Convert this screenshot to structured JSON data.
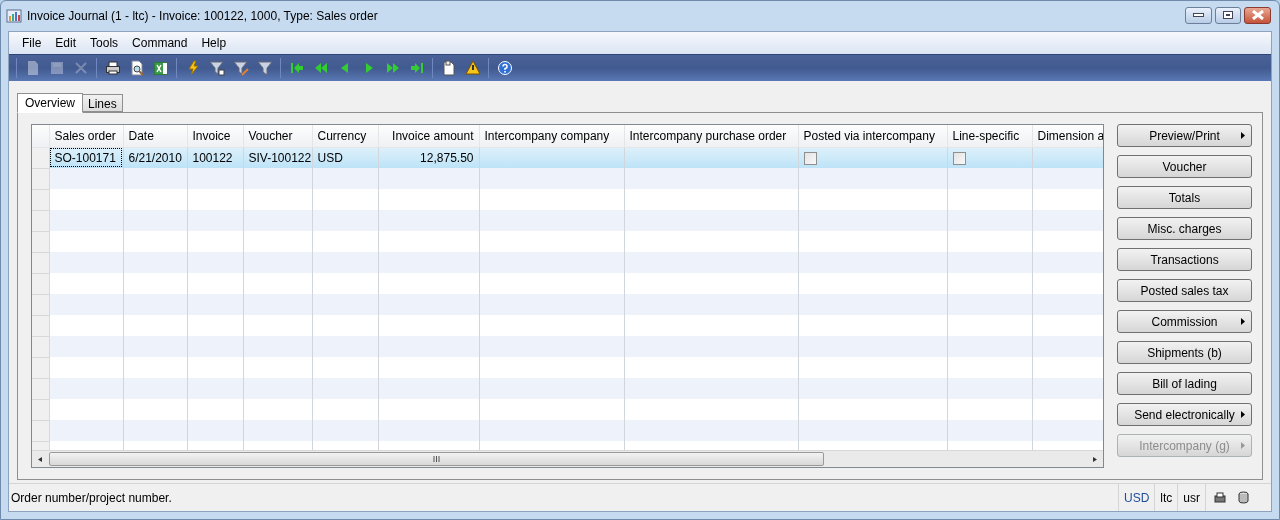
{
  "window": {
    "title": "Invoice Journal (1 - ltc) - Invoice: 100122, 1000, Type: Sales order"
  },
  "menu": [
    "File",
    "Edit",
    "Tools",
    "Command",
    "Help"
  ],
  "toolbar": [
    {
      "kind": "new",
      "disabled": true
    },
    {
      "kind": "save",
      "disabled": true
    },
    {
      "kind": "delete",
      "disabled": true
    },
    {
      "kind": "sep"
    },
    {
      "kind": "print",
      "disabled": false
    },
    {
      "kind": "preview",
      "disabled": false
    },
    {
      "kind": "excel",
      "disabled": false
    },
    {
      "kind": "sep"
    },
    {
      "kind": "filter-lightning",
      "disabled": false
    },
    {
      "kind": "filter-form",
      "disabled": false
    },
    {
      "kind": "filter-edit",
      "disabled": false
    },
    {
      "kind": "filter-remove",
      "disabled": false
    },
    {
      "kind": "sep"
    },
    {
      "kind": "first",
      "disabled": false
    },
    {
      "kind": "prev-page",
      "disabled": false
    },
    {
      "kind": "prev",
      "disabled": false
    },
    {
      "kind": "next",
      "disabled": false
    },
    {
      "kind": "next-page",
      "disabled": false
    },
    {
      "kind": "last",
      "disabled": false
    },
    {
      "kind": "sep"
    },
    {
      "kind": "document",
      "disabled": false
    },
    {
      "kind": "alert",
      "disabled": false
    },
    {
      "kind": "sep"
    },
    {
      "kind": "help",
      "disabled": false
    }
  ],
  "tabs": [
    {
      "label": "Overview",
      "selected": true
    },
    {
      "label": "Lines",
      "selected": false
    }
  ],
  "table": {
    "columns": [
      {
        "label": "Sales order"
      },
      {
        "label": "Date"
      },
      {
        "label": "Invoice"
      },
      {
        "label": "Voucher"
      },
      {
        "label": "Currency"
      },
      {
        "label": "Invoice amount"
      },
      {
        "label": "Intercompany company"
      },
      {
        "label": "Intercompany purchase order"
      },
      {
        "label": "Posted via intercompany"
      },
      {
        "label": "Line-specific"
      },
      {
        "label": "Dimension a"
      }
    ],
    "rows": [
      {
        "selected": true,
        "cells": [
          {
            "kind": "text",
            "text": "SO-100171"
          },
          {
            "kind": "text",
            "text": "6/21/2010"
          },
          {
            "kind": "text",
            "text": "100122"
          },
          {
            "kind": "text",
            "text": "SIV-100122"
          },
          {
            "kind": "text",
            "text": "USD"
          },
          {
            "kind": "text",
            "text": "12,875.50"
          },
          {
            "kind": "text",
            "text": ""
          },
          {
            "kind": "text",
            "text": ""
          },
          {
            "kind": "checkbox",
            "checked": false
          },
          {
            "kind": "checkbox",
            "checked": false
          },
          {
            "kind": "text",
            "text": ""
          }
        ]
      }
    ]
  },
  "buttons": [
    {
      "label": "Preview/Print",
      "menu": true,
      "disabled": false
    },
    {
      "label": "Voucher",
      "menu": false,
      "disabled": false
    },
    {
      "label": "Totals",
      "menu": false,
      "disabled": false
    },
    {
      "label": "Misc. charges",
      "menu": false,
      "disabled": false
    },
    {
      "label": "Transactions",
      "menu": false,
      "disabled": false
    },
    {
      "label": "Posted sales tax",
      "menu": false,
      "disabled": false
    },
    {
      "label": "Commission",
      "menu": true,
      "disabled": false
    },
    {
      "label": "Shipments (b)",
      "menu": false,
      "disabled": false
    },
    {
      "label": "Bill of lading",
      "menu": false,
      "disabled": false
    },
    {
      "label": "Send electronically",
      "menu": true,
      "disabled": false
    },
    {
      "label": "Intercompany (g)",
      "menu": true,
      "disabled": true
    }
  ],
  "status_bar": {
    "message": "Order number/project number.",
    "fields": [
      {
        "text": "USD",
        "highlight": true
      },
      {
        "text": "ltc",
        "highlight": false
      },
      {
        "text": "usr",
        "highlight": false
      }
    ]
  }
}
